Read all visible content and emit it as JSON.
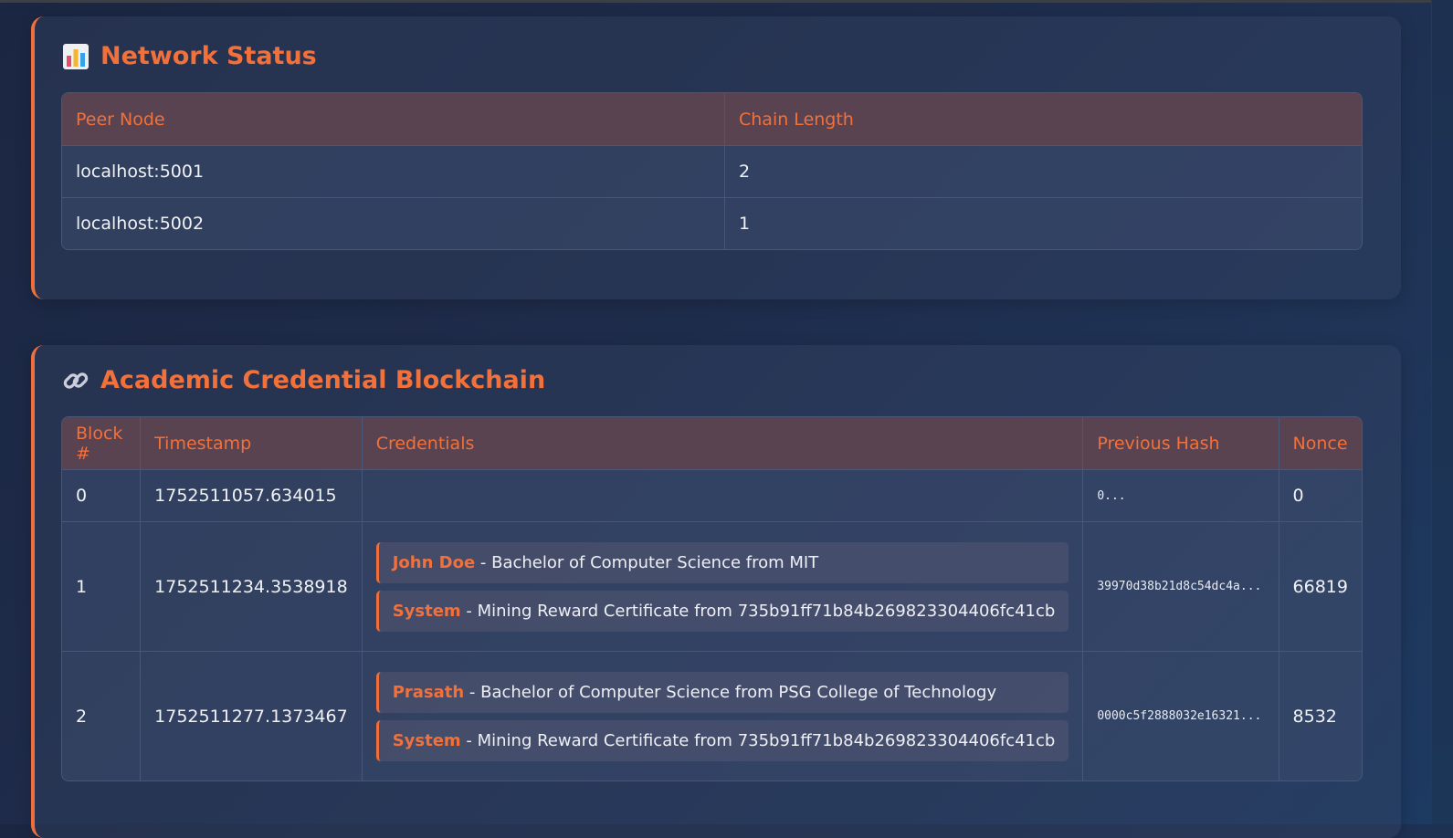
{
  "network": {
    "title": "Network Status",
    "icon": "bar-chart-icon",
    "columns": [
      "Peer Node",
      "Chain Length"
    ],
    "rows": [
      {
        "peer": "localhost:5001",
        "length": "2"
      },
      {
        "peer": "localhost:5002",
        "length": "1"
      }
    ]
  },
  "blockchain": {
    "title": "Academic Credential Blockchain",
    "icon": "link-icon",
    "columns": [
      "Block #",
      "Timestamp",
      "Credentials",
      "Previous Hash",
      "Nonce"
    ],
    "blocks": [
      {
        "index": "0",
        "timestamp": "1752511057.634015",
        "credentials": [],
        "previous_hash": "0...",
        "nonce": "0"
      },
      {
        "index": "1",
        "timestamp": "1752511234.3538918",
        "credentials": [
          {
            "name": "John Doe",
            "detail": " - Bachelor of Computer Science from MIT"
          },
          {
            "name": "System",
            "detail": " - Mining Reward Certificate from 735b91ff71b84b269823304406fc41cb"
          }
        ],
        "previous_hash": "39970d38b21d8c54dc4a...",
        "nonce": "66819"
      },
      {
        "index": "2",
        "timestamp": "1752511277.1373467",
        "credentials": [
          {
            "name": "Prasath",
            "detail": " - Bachelor of Computer Science from PSG College of Technology"
          },
          {
            "name": "System",
            "detail": " - Mining Reward Certificate from 735b91ff71b84b269823304406fc41cb"
          }
        ],
        "previous_hash": "0000c5f2888032e16321...",
        "nonce": "8532"
      }
    ]
  },
  "colors": {
    "accent": "#f2703a",
    "background": "#1e2b4a",
    "header_bg": "#5a4350"
  }
}
